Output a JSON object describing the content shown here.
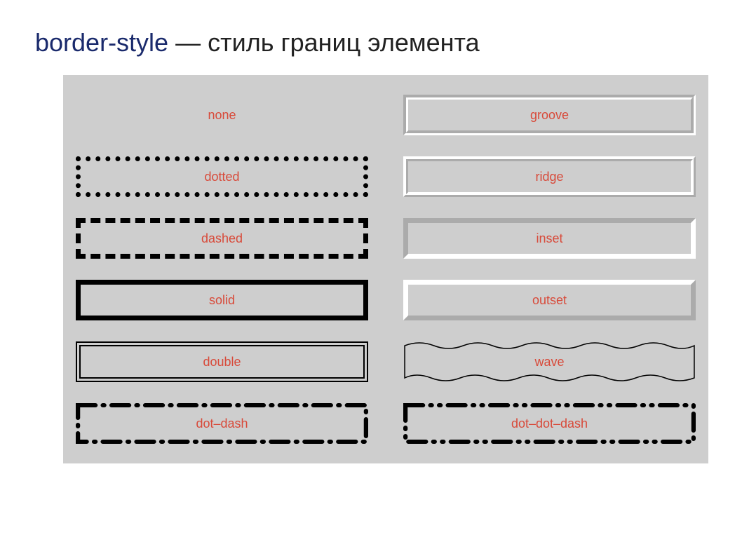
{
  "heading": {
    "property": "border-style",
    "dash": " — ",
    "description": "стиль границ элемента"
  },
  "swatches": {
    "left": [
      {
        "key": "none",
        "label": "none",
        "cls": "s-none"
      },
      {
        "key": "dotted",
        "label": "dotted",
        "cls": "s-dotted"
      },
      {
        "key": "dashed",
        "label": "dashed",
        "cls": "s-dashed"
      },
      {
        "key": "solid",
        "label": "solid",
        "cls": "s-solid"
      },
      {
        "key": "double",
        "label": "double",
        "cls": "s-double"
      },
      {
        "key": "dotdash",
        "label": "dot–dash",
        "cls": "s-dotdash"
      }
    ],
    "right": [
      {
        "key": "groove",
        "label": "groove",
        "cls": "s-groove"
      },
      {
        "key": "ridge",
        "label": "ridge",
        "cls": "s-ridge"
      },
      {
        "key": "inset",
        "label": "inset",
        "cls": "s-inset"
      },
      {
        "key": "outset",
        "label": "outset",
        "cls": "s-outset"
      },
      {
        "key": "wave",
        "label": "wave",
        "cls": "s-wave"
      },
      {
        "key": "dotdotdash",
        "label": "dot–dot–dash",
        "cls": "s-dotdotdash"
      }
    ]
  }
}
